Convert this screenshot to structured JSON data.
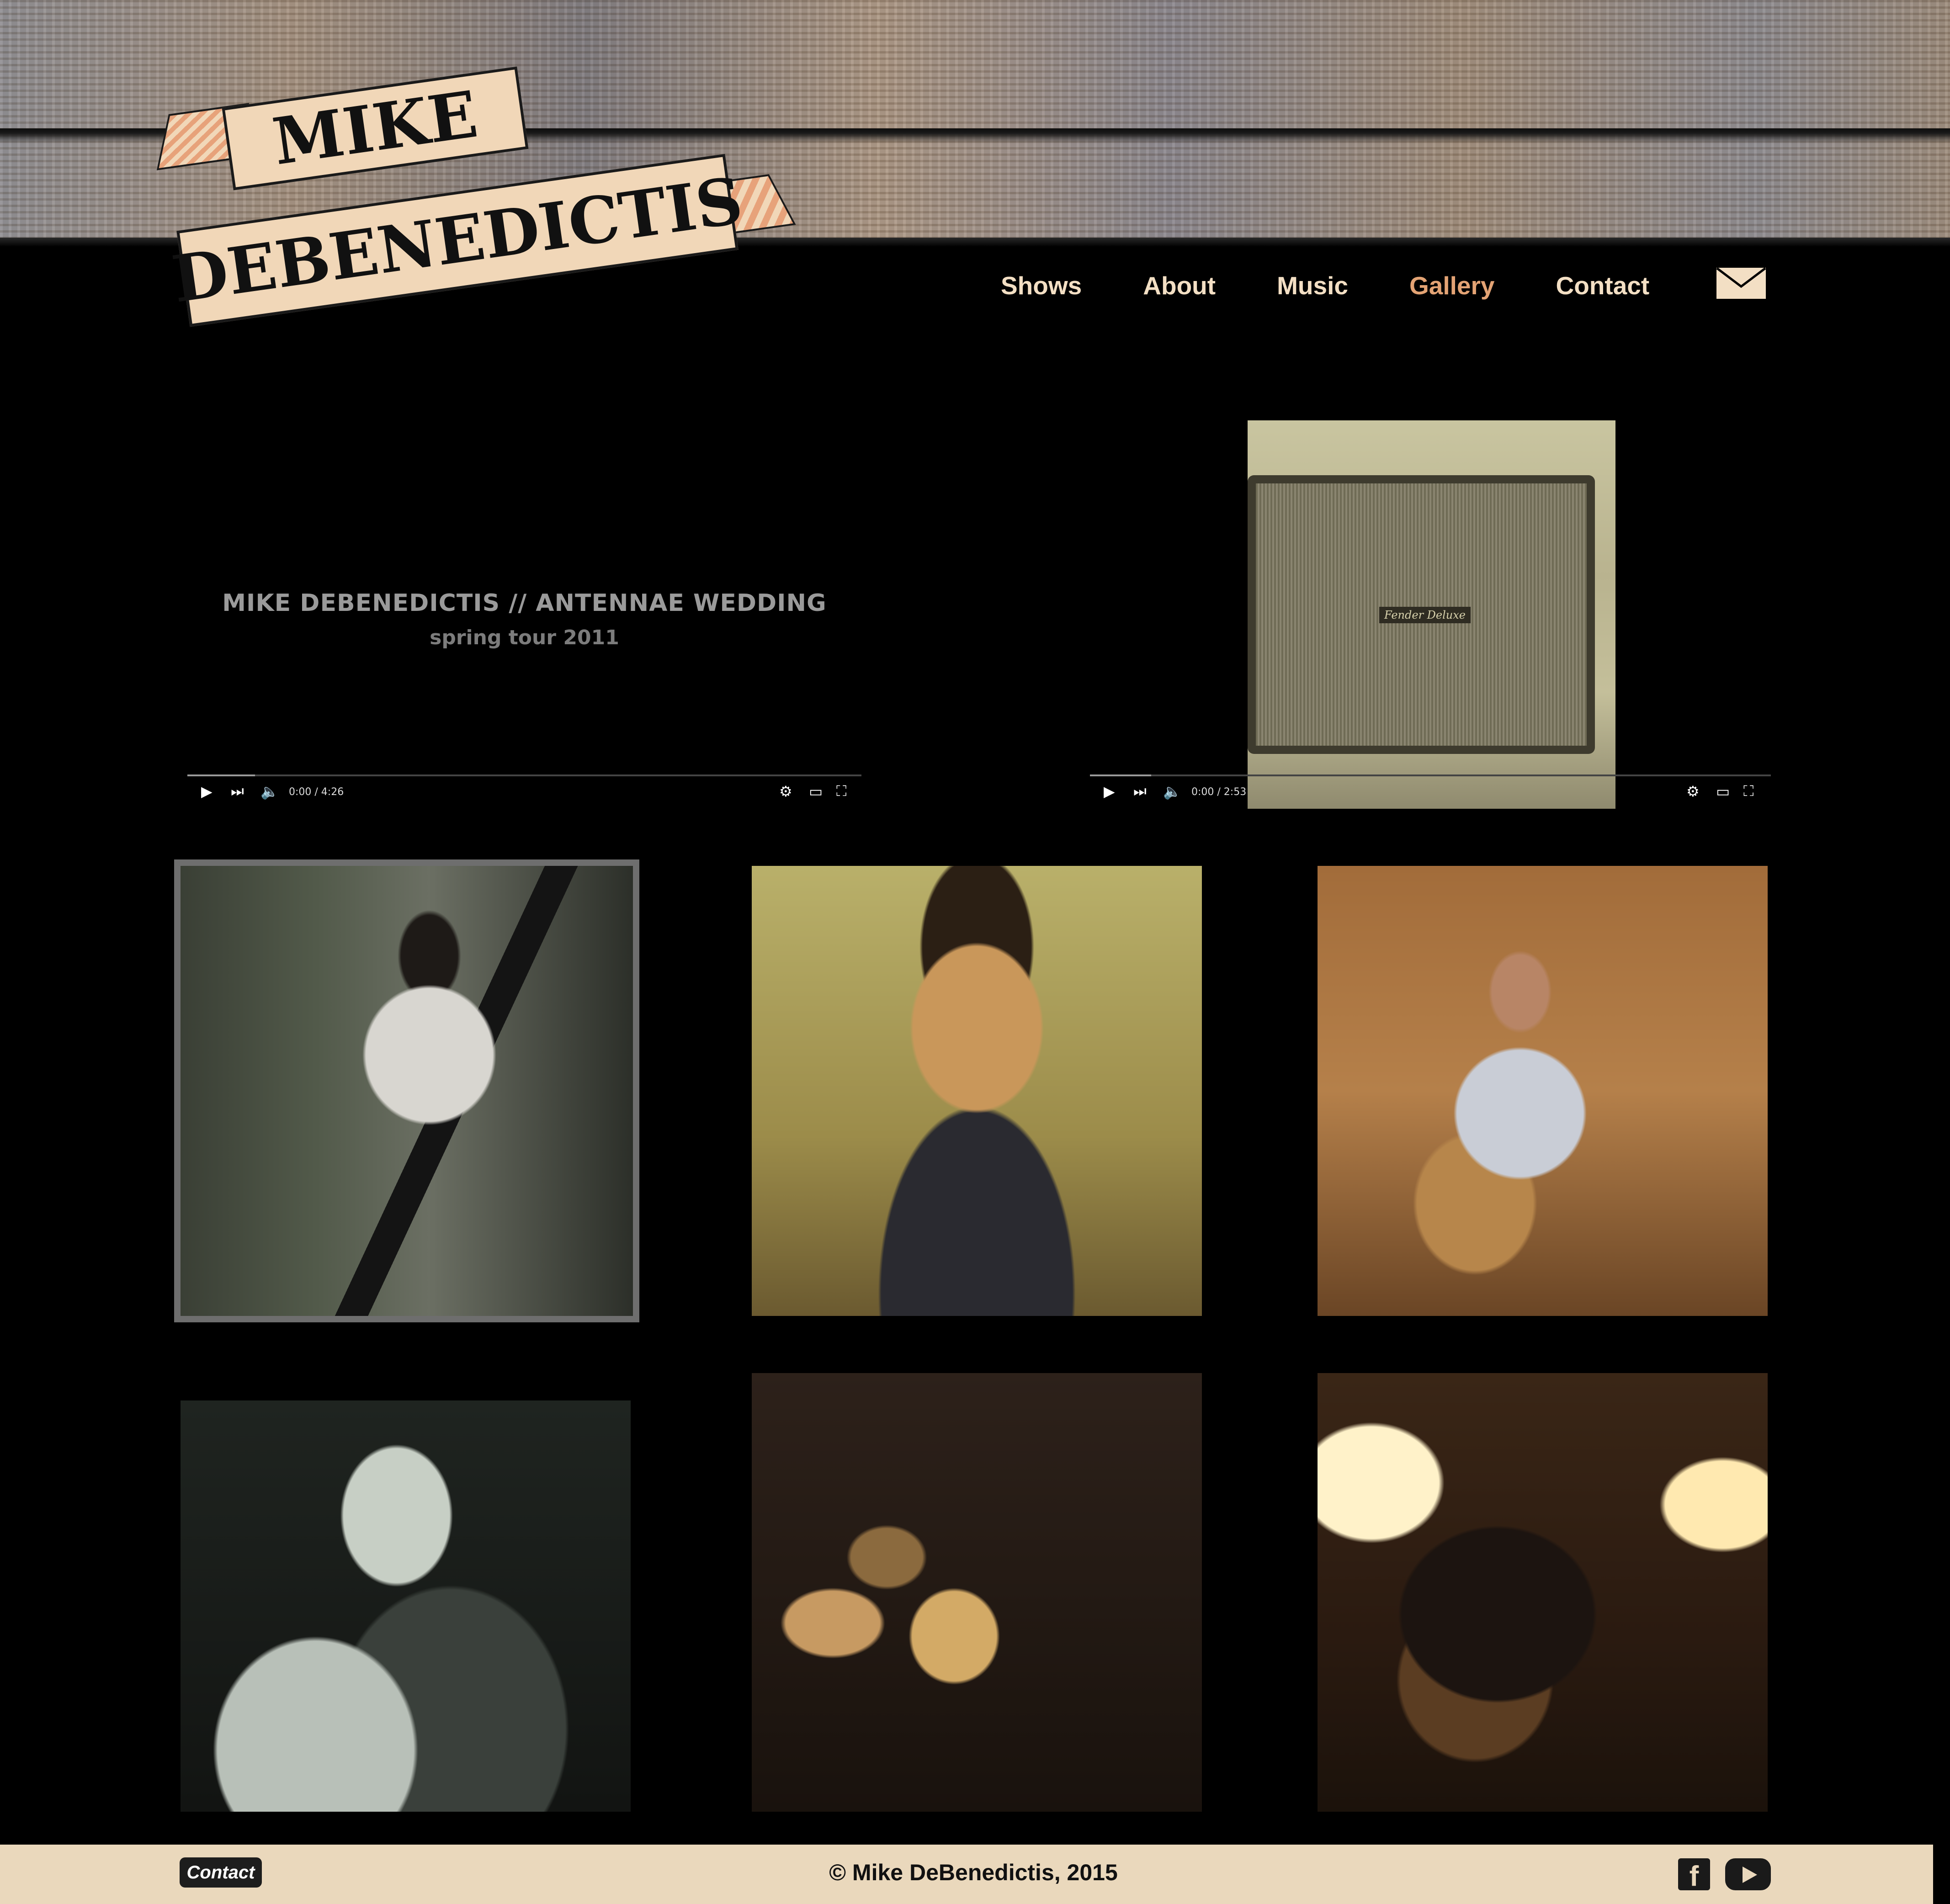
{
  "site": {
    "logo_line1": "MIKE",
    "logo_line2": "DEBENEDICTIS"
  },
  "nav": {
    "items": [
      {
        "label": "Shows"
      },
      {
        "label": "About"
      },
      {
        "label": "Music"
      },
      {
        "label": "Gallery",
        "active": true
      },
      {
        "label": "Contact"
      }
    ],
    "mail_icon": "envelope-icon"
  },
  "videos": [
    {
      "title": "MIKE DEBENEDICTIS // ANTENNAE WEDDING",
      "subtitle": "spring tour 2011",
      "time": "0:00 / 4:26"
    },
    {
      "title": "",
      "subtitle": "",
      "time": "0:00 / 2:53",
      "thumb_label": "Fender Deluxe"
    }
  ],
  "gallery": {
    "photo_count": 6,
    "selected_index": 0
  },
  "footer": {
    "contact_label": "Contact",
    "copyright": "© Mike DeBenedictis, 2015",
    "icons": [
      "facebook-icon",
      "youtube-icon"
    ]
  },
  "colors": {
    "nav_text": "#f3dfc4",
    "nav_active": "#e3a374",
    "footer_bg": "#ead8bc"
  }
}
